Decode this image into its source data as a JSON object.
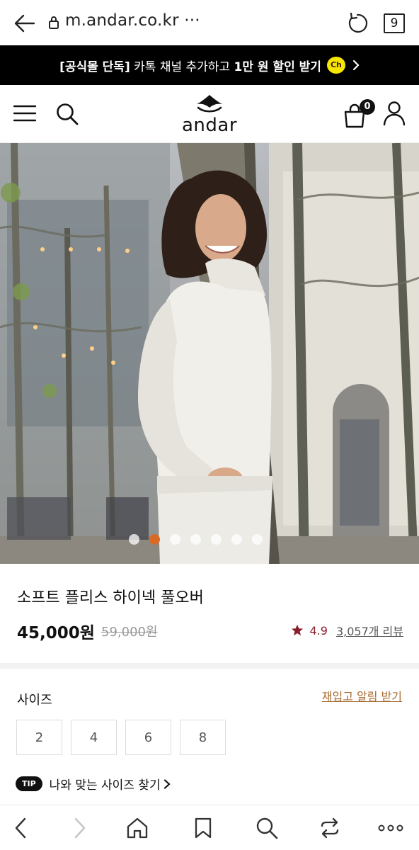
{
  "browser": {
    "url": "m.andar.co.kr ···",
    "tab_count": "9"
  },
  "promo": {
    "bracket_text": "[공식몰 단독]",
    "middle_text": " 카톡 채널 추가하고 ",
    "bold_text": "1만 원 할인 받기",
    "channel_badge": "Ch"
  },
  "header": {
    "logo_text": "andar",
    "cart_count": "0"
  },
  "hero": {
    "slide_count": 7,
    "active_slide": 2
  },
  "product": {
    "name": "소프트 플리스 하이넥 풀오버",
    "price": "45,000원",
    "original_price": "59,000원",
    "rating": "4.9",
    "reviews": "3,057개 리뷰"
  },
  "size_section": {
    "label": "사이즈",
    "restock_link": "재입고 알림 받기",
    "options": [
      "2",
      "4",
      "6",
      "8"
    ],
    "tip_badge": "TIP",
    "tip_text": "나와 맞는 사이즈 찾기"
  },
  "colors": {
    "accent": "#d86a25",
    "rating": "#8a1f2c",
    "restock": "#a56a2f",
    "kakao": "#f7e600"
  }
}
